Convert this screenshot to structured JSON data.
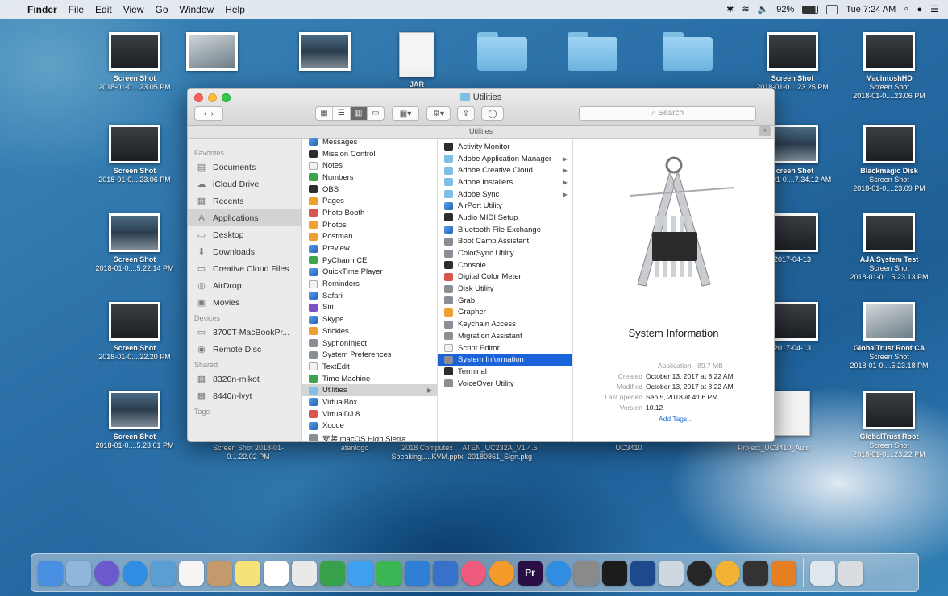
{
  "menubar": {
    "app": "Finder",
    "items": [
      "File",
      "Edit",
      "View",
      "Go",
      "Window",
      "Help"
    ],
    "battery": "92%",
    "clock": "Tue 7:24 AM"
  },
  "desktop_icons": [
    {
      "line1": "Screen Shot",
      "line2": "2018-01-0....23.05 PM",
      "kind": "shot"
    },
    {
      "line1": "",
      "line2": "",
      "kind": "shot3"
    },
    {
      "line1": "",
      "line2": "",
      "kind": "shot2"
    },
    {
      "line1": "JAR",
      "line2": "",
      "kind": "doc"
    },
    {
      "line1": "",
      "line2": "",
      "kind": "folder"
    },
    {
      "line1": "",
      "line2": "",
      "kind": "folder"
    },
    {
      "line1": "",
      "line2": "",
      "kind": "folder"
    },
    {
      "line1": "Screen Shot",
      "line2": "2018-01-0....23.25 PM",
      "kind": "shot"
    },
    {
      "line1": "MacintoshHD",
      "line2": "Screen Shot",
      "line3": "2018-01-0....23.06 PM",
      "kind": "shot"
    },
    {
      "line1": "Screen Shot",
      "line2": "2018-01-0....23.06 PM",
      "kind": "shot"
    },
    {
      "line1": "Screen Shot",
      "line2": "2018-01-0....7.34.12 AM",
      "kind": "shot2"
    },
    {
      "line1": "Blackmagic Disk",
      "line2": "Screen Shot",
      "line3": "2018-01-0....23.09 PM",
      "kind": "shot"
    },
    {
      "line1": "Screen Shot",
      "line2": "2018-01-0....5.22.14 PM",
      "kind": "shot2"
    },
    {
      "line1": "",
      "line2": "2017-04-13",
      "kind": "shot"
    },
    {
      "line1": "AJA System Test",
      "line2": "Screen Shot",
      "line3": "2018-01-0....5.23.13 PM",
      "kind": "shot"
    },
    {
      "line1": "Screen Shot",
      "line2": "2018-01-0....22.20 PM",
      "kind": "shot"
    },
    {
      "line1": "",
      "line2": "2017-04-13",
      "kind": "shot"
    },
    {
      "line1": "GlobalTrust Root CA",
      "line2": "Screen Shot",
      "line3": "2018-01-0....5.23.18 PM",
      "kind": "shot3"
    },
    {
      "line1": "Screen Shot",
      "line2": "2018-01-0....5.23.01 PM",
      "kind": "shot2"
    },
    {
      "line1": "",
      "line2": "",
      "kind": "doc"
    },
    {
      "line1": "GlobalTrust Root",
      "line2": "Screen Shot",
      "line3": "2018-01-0....23.22 PM",
      "kind": "shot"
    }
  ],
  "desktop_bottom_labels": [
    "Screen Shot 2018-01-0....22.02 PM",
    "atenlogo",
    "2018 Computex Speaking.....KVM.pptx",
    "ATEN_UC232A_V1.4.5 20180861_Sign.pkg",
    "UC3410",
    "Project_UC3410_Auto"
  ],
  "finder": {
    "title": "Utilities",
    "path_title": "Utilities",
    "search_placeholder": "Search",
    "favorites_header": "Favorites",
    "devices_header": "Devices",
    "shared_header": "Shared",
    "tags_header": "Tags",
    "favorites": [
      {
        "label": "Documents",
        "icon": "document-icon"
      },
      {
        "label": "iCloud Drive",
        "icon": "cloud-icon"
      },
      {
        "label": "Recents",
        "icon": "recents-icon"
      },
      {
        "label": "Applications",
        "icon": "applications-icon",
        "selected": true
      },
      {
        "label": "Desktop",
        "icon": "desktop-icon"
      },
      {
        "label": "Downloads",
        "icon": "downloads-icon"
      },
      {
        "label": "Creative Cloud Files",
        "icon": "folder-icon"
      },
      {
        "label": "AirDrop",
        "icon": "airdrop-icon"
      },
      {
        "label": "Movies",
        "icon": "movies-icon"
      }
    ],
    "devices": [
      {
        "label": "3700T-MacBookPr...",
        "icon": "laptop-icon"
      },
      {
        "label": "Remote Disc",
        "icon": "disc-icon"
      }
    ],
    "shared": [
      {
        "label": "8320n-mikot",
        "icon": "server-icon"
      },
      {
        "label": "8440n-lvyt",
        "icon": "server-icon"
      }
    ],
    "applications": [
      {
        "label": "Messages",
        "icon": "app"
      },
      {
        "label": "Mission Control",
        "icon": "blk"
      },
      {
        "label": "Notes",
        "icon": "wht"
      },
      {
        "label": "Numbers",
        "icon": "grn"
      },
      {
        "label": "OBS",
        "icon": "blk"
      },
      {
        "label": "Pages",
        "icon": "ora"
      },
      {
        "label": "Photo Booth",
        "icon": "red"
      },
      {
        "label": "Photos",
        "icon": "ora"
      },
      {
        "label": "Postman",
        "icon": "ora"
      },
      {
        "label": "Preview",
        "icon": "app"
      },
      {
        "label": "PyCharm CE",
        "icon": "grn"
      },
      {
        "label": "QuickTime Player",
        "icon": "app"
      },
      {
        "label": "Reminders",
        "icon": "wht"
      },
      {
        "label": "Safari",
        "icon": "app"
      },
      {
        "label": "Siri",
        "icon": "pur"
      },
      {
        "label": "Skype",
        "icon": "app"
      },
      {
        "label": "Stickies",
        "icon": "ora"
      },
      {
        "label": "SyphonInject",
        "icon": "gry"
      },
      {
        "label": "System Preferences",
        "icon": "gry"
      },
      {
        "label": "TextEdit",
        "icon": "wht"
      },
      {
        "label": "Time Machine",
        "icon": "grn"
      },
      {
        "label": "Utilities",
        "icon": "fold",
        "selected": true,
        "folder": true
      },
      {
        "label": "VirtualBox",
        "icon": "app"
      },
      {
        "label": "VirtualDJ 8",
        "icon": "red"
      },
      {
        "label": "Xcode",
        "icon": "app"
      },
      {
        "label": "安装 macOS High Sierra",
        "icon": "gry"
      }
    ],
    "utilities": [
      {
        "label": "Activity Monitor",
        "icon": "blk"
      },
      {
        "label": "Adobe Application Manager",
        "icon": "fold",
        "folder": true
      },
      {
        "label": "Adobe Creative Cloud",
        "icon": "fold",
        "folder": true
      },
      {
        "label": "Adobe Installers",
        "icon": "fold",
        "folder": true
      },
      {
        "label": "Adobe Sync",
        "icon": "fold",
        "folder": true
      },
      {
        "label": "AirPort Utility",
        "icon": "app"
      },
      {
        "label": "Audio MIDI Setup",
        "icon": "blk"
      },
      {
        "label": "Bluetooth File Exchange",
        "icon": "app"
      },
      {
        "label": "Boot Camp Assistant",
        "icon": "gry"
      },
      {
        "label": "ColorSync Utility",
        "icon": "gry"
      },
      {
        "label": "Console",
        "icon": "blk"
      },
      {
        "label": "Digital Color Meter",
        "icon": "red"
      },
      {
        "label": "Disk Utility",
        "icon": "gry"
      },
      {
        "label": "Grab",
        "icon": "gry"
      },
      {
        "label": "Grapher",
        "icon": "ora"
      },
      {
        "label": "Keychain Access",
        "icon": "gry"
      },
      {
        "label": "Migration Assistant",
        "icon": "gry"
      },
      {
        "label": "Script Editor",
        "icon": "wht"
      },
      {
        "label": "System Information",
        "icon": "gry",
        "highlighted": true
      },
      {
        "label": "Terminal",
        "icon": "blk"
      },
      {
        "label": "VoiceOver Utility",
        "icon": "gry"
      }
    ],
    "preview": {
      "name": "System Information",
      "kind": "Application - 89.7 MB",
      "meta": [
        {
          "key": "Created",
          "value": "October 13, 2017 at 8:22 AM"
        },
        {
          "key": "Modified",
          "value": "October 13, 2017 at 8:22 AM"
        },
        {
          "key": "Last opened",
          "value": "Sep 5, 2018 at 4:06 PM"
        },
        {
          "key": "Version",
          "value": "10.12"
        }
      ],
      "add_tags": "Add Tags..."
    }
  },
  "dock": {
    "apps": [
      {
        "name": "finder-icon",
        "color": "#4a90e2"
      },
      {
        "name": "photos-icon",
        "color": "#8fb7de"
      },
      {
        "name": "siri-icon",
        "color": "#6a5acd"
      },
      {
        "name": "safari-icon",
        "color": "#2f8de4"
      },
      {
        "name": "photos-viewer-icon",
        "color": "#5a9fd4"
      },
      {
        "name": "calendar-icon",
        "color": "#f5f5f5"
      },
      {
        "name": "contacts-icon",
        "color": "#c49a6c"
      },
      {
        "name": "notes-icon",
        "color": "#f7e27a"
      },
      {
        "name": "reminders-icon",
        "color": "#ffffff"
      },
      {
        "name": "photos-app-icon",
        "color": "#e9e9e9"
      },
      {
        "name": "numbers-icon",
        "color": "#36a14a"
      },
      {
        "name": "messages-icon",
        "color": "#3fa0f0"
      },
      {
        "name": "facetime-icon",
        "color": "#3cb554"
      },
      {
        "name": "pages-icon",
        "color": "#2f7fd5"
      },
      {
        "name": "keynote-icon",
        "color": "#3672c9"
      },
      {
        "name": "itunes-icon",
        "color": "#f05a7e"
      },
      {
        "name": "ibooks-icon",
        "color": "#f39c2b"
      },
      {
        "name": "premiere-icon",
        "color": "#2a0f45",
        "text": "Pr"
      },
      {
        "name": "app-store-icon",
        "color": "#2f8de4"
      },
      {
        "name": "system-preferences-icon",
        "color": "#8a8a8a"
      },
      {
        "name": "terminal-icon",
        "color": "#1c1c1c"
      },
      {
        "name": "virtualbox-icon",
        "color": "#1d4a8c"
      },
      {
        "name": "migration-icon",
        "color": "#cfd8e0"
      },
      {
        "name": "obs-icon",
        "color": "#262626"
      },
      {
        "name": "chrome-icon",
        "color": "#f2b233"
      },
      {
        "name": "console-icon",
        "color": "#333333"
      },
      {
        "name": "xcode-icon",
        "color": "#e67e22"
      }
    ],
    "right": [
      {
        "name": "downloads-stack-icon",
        "color": "#dfe6ee"
      },
      {
        "name": "trash-icon",
        "color": "#d9dde2"
      }
    ]
  }
}
